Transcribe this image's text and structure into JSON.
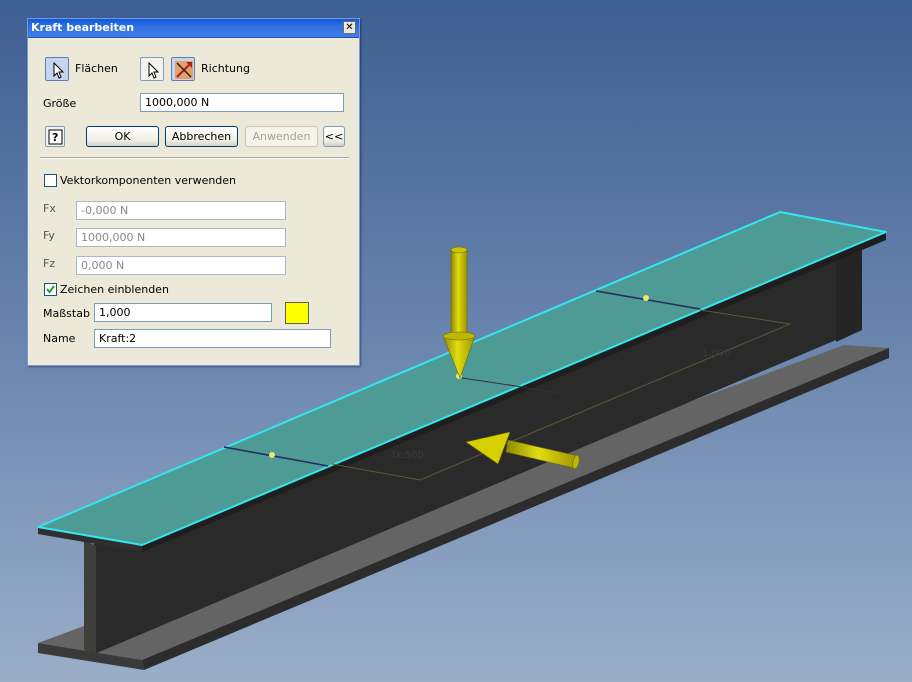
{
  "dialog": {
    "title": "Kraft bearbeiten",
    "close_glyph": "✕",
    "faces_label": "Flächen",
    "direction_label": "Richtung",
    "size_label": "Größe",
    "size_value": "1000,000 N",
    "help_glyph": "?",
    "ok_label": "OK",
    "cancel_label": "Abbrechen",
    "apply_label": "Anwenden",
    "collapse_label": "<<",
    "vector_components_label": "Vektorkomponenten verwenden",
    "vector_components_checked": false,
    "fx_label": "Fx",
    "fx_value": "-0,000 N",
    "fy_label": "Fy",
    "fy_value": "1000,000 N",
    "fz_label": "Fz",
    "fz_value": "0,000 N",
    "show_glyphs_label": "Zeichen einblenden",
    "show_glyphs_checked": true,
    "scale_label": "Maßstab",
    "scale_value": "1,000",
    "glyph_color": "#FFFF00",
    "name_label": "Name",
    "name_value": "Kraft:2"
  },
  "scene": {
    "dim_label_center": "fx:500",
    "dim_label_right": "1.000",
    "face_highlight_color": "#33E6F0",
    "arrow_color": "#D7D000"
  }
}
